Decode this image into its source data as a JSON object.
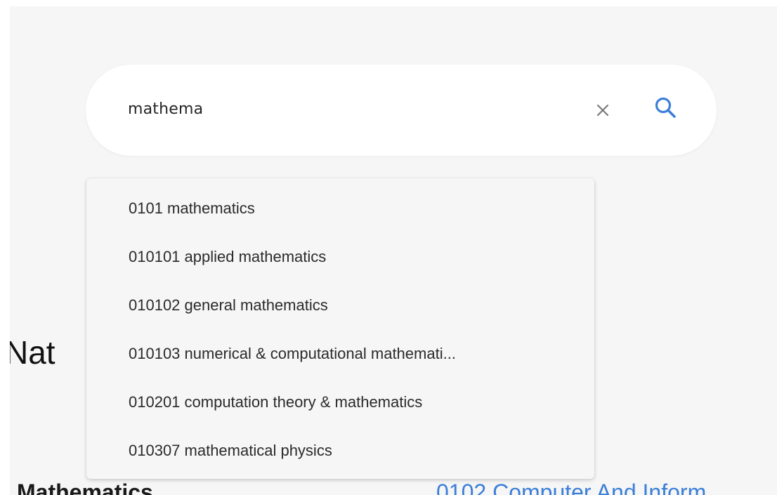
{
  "search": {
    "value": "mathema",
    "clear_icon": "close-icon",
    "search_icon": "search-icon",
    "accent_color": "#3c7fd8"
  },
  "suggestions": [
    "0101 mathematics",
    "010101 applied mathematics",
    "010102 general mathematics",
    "010103 numerical & computational mathemati...",
    "010201 computation theory & mathematics",
    "010307 mathematical physics"
  ],
  "background": {
    "heading": "Nat",
    "left_subheading": "Mathematics",
    "right_link": "0102 Computer And Inform"
  }
}
